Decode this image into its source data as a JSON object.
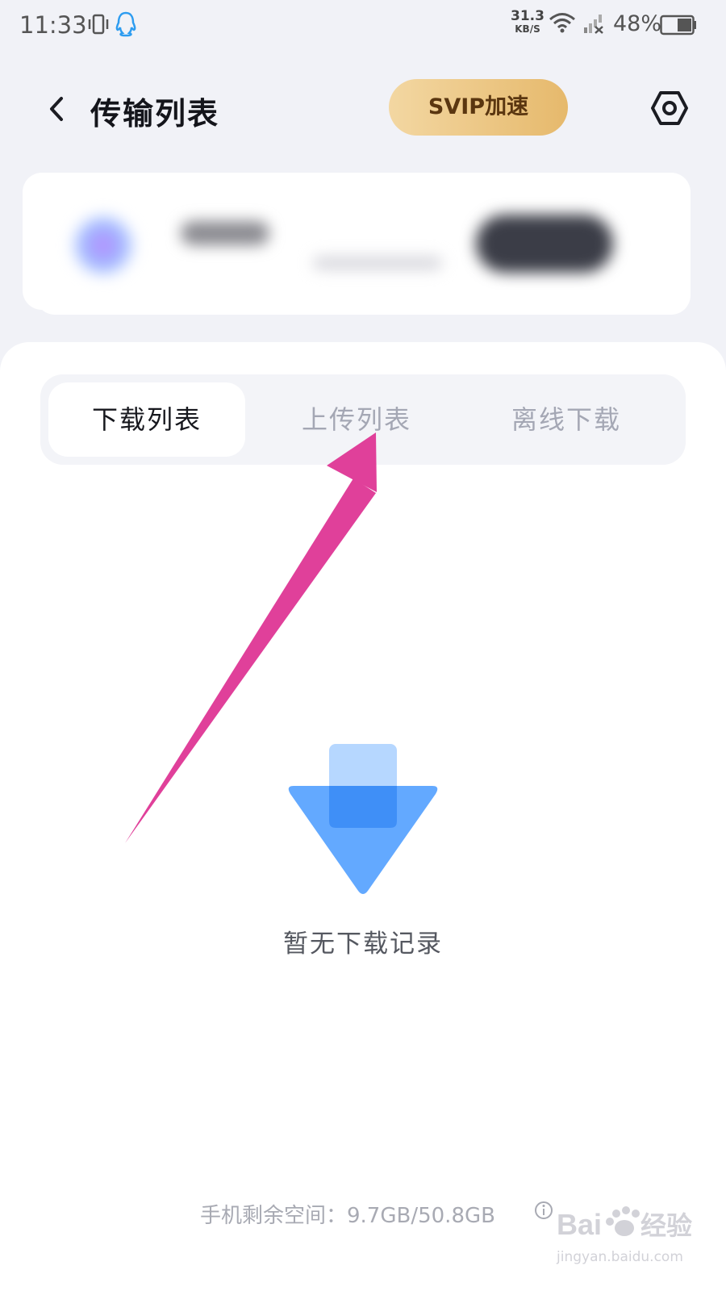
{
  "status_bar": {
    "time": "11:33",
    "net_speed_value": "31.3",
    "net_speed_unit": "KB/S",
    "battery": "48%",
    "icons": [
      "vibrate-icon",
      "qq-icon",
      "wifi-icon",
      "signal-icon",
      "battery-icon"
    ]
  },
  "header": {
    "title": "传输列表",
    "svip_label": "SVIP加速",
    "icons": [
      "back-icon",
      "settings-icon"
    ]
  },
  "tabs": [
    {
      "label": "下载列表",
      "active": true
    },
    {
      "label": "上传列表",
      "active": false
    },
    {
      "label": "离线下载",
      "active": false
    }
  ],
  "empty_state": {
    "message": "暂无下载记录",
    "icon": "download-arrow-icon"
  },
  "footer": {
    "storage_text": "手机剩余空间：9.7GB/50.8GB"
  },
  "watermark": {
    "text": "jingyan.baidu.com",
    "logo_text": "Bai du 经验"
  },
  "colors": {
    "svip_gradient_start": "#f3d7a2",
    "svip_gradient_end": "#e6b96c",
    "arrow_annotation": "#e0409a",
    "empty_icon_blue": "#4a9cff"
  }
}
